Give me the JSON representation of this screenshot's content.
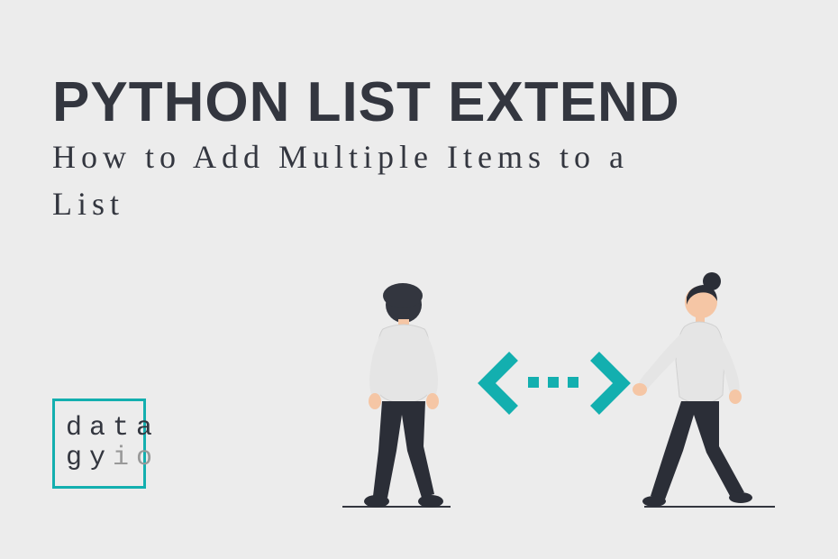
{
  "title": "PYTHON LIST EXTEND",
  "subtitle": "How to Add Multiple Items to a List",
  "logo": {
    "line1": "data",
    "line2a": "gy",
    "line2b": "io"
  },
  "colors": {
    "accent": "#13AFAF",
    "dark": "#33363F",
    "bg": "#ECECEC"
  }
}
